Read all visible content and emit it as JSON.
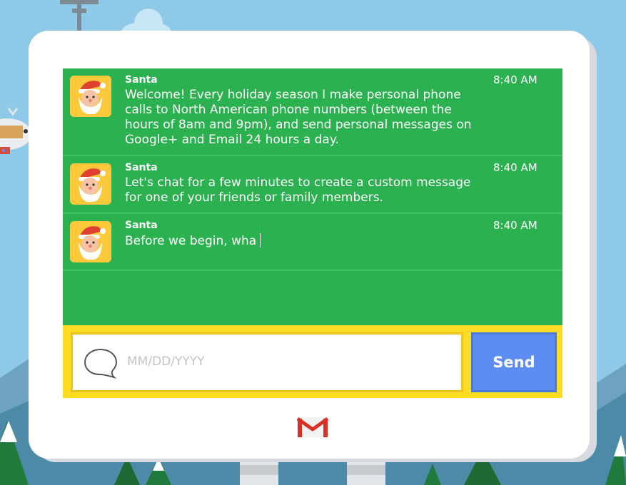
{
  "messages": [
    {
      "sender": "Santa",
      "time": "8:40 AM",
      "text": "Welcome! Every holiday season I make personal phone calls to North American phone numbers (between the hours of 8am and 9pm), and send personal messages on Google+ and Email 24 hours a day."
    },
    {
      "sender": "Santa",
      "time": "8:40 AM",
      "text": "Let's chat for a few minutes to create a custom message for one of your friends or family members."
    },
    {
      "sender": "Santa",
      "time": "8:40 AM",
      "text": "Before we begin, wha"
    }
  ],
  "composer": {
    "placeholder": "MM/DD/YYYY",
    "send_label": "Send"
  },
  "icons": {
    "avatar": "santa-face-icon",
    "input": "speech-bubble-icon",
    "footer": "gmail-icon"
  },
  "colors": {
    "chat_background": "#2bb14f",
    "composer_background": "#fcdc23",
    "send_button": "#5b8df2",
    "avatar_background": "#fdc93a"
  }
}
